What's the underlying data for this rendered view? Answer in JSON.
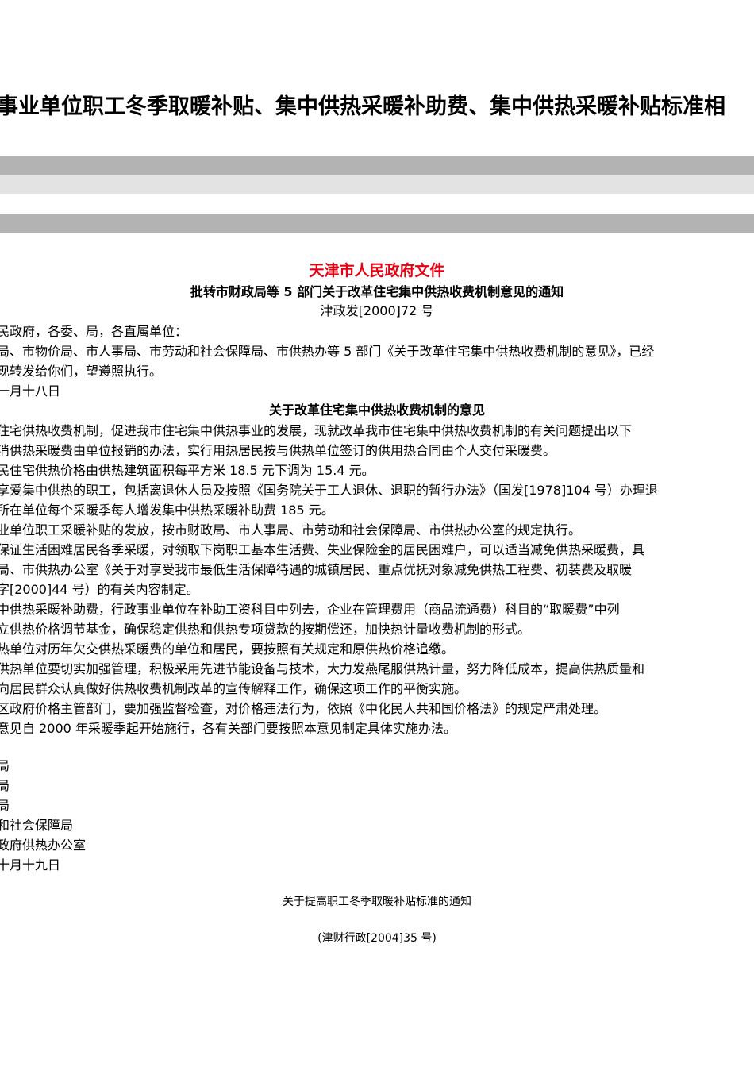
{
  "title": "事业单位职工冬季取暖补贴、集中供热采暖补助费、集中供热采暖补贴标准相",
  "header": {
    "issuer": "天津市人民政府文件",
    "issuer_color": "#e60012",
    "subtitle": "批转市财政局等 5 部门关于改革住宅集中供热收费机制意见的通知",
    "doc_number": "津政发[2000]72 号"
  },
  "notice_lines": [
    "民政府，各委、局，各直属单位：",
    "局、市物价局、市人事局、市劳动和社会保障局、市供热办等 5 部门《关于改革住宅集中供热收费机制的意见》，已经",
    "现转发给你们，望遵照执行。",
    "一月十八日"
  ],
  "section": {
    "title": "关于改革住宅集中供热收费机制的意见",
    "lines": [
      "住宅供热收费机制，促进我市住宅集中供热事业的发展，现就改革我市住宅集中供热收费机制的有关问题提出以下",
      "消供热采暖费由单位报销的办法，实行用热居民按与供热单位签订的供用热合同由个人交付采暖费。",
      "民住宅供热价格由供热建筑面积每平方米 18.5 元下调为 15.4 元。",
      "享爱集中供热的职工，包括离退休人员及按照《国务院关于工人退休、退职的暂行办法》（国发[1978]104 号）办理退",
      "所在单位每个采暖季每人增发集中供热采暖补助费 185 元。",
      "业单位职工采暖补贴的发放，按市财政局、市人事局、市劳动和社会保障局、市供热办公室的规定执行。",
      "保证生活困难居民各季采暖，对领取下岗职工基本生活费、失业保险金的居民困难户，可以适当减免供热采暖费，具",
      "局、市供热办公室《关于对享受我市最低生活保障待遇的城镇居民、重点优抚对象减免供热工程费、初装费及取暖",
      "字[2000]44 号）的有关内容制定。",
      "中供热采暖补助费，行政事业单位在补助工资科目中列去，企业在管理费用（商品流通费）科目的“取暖费”中列",
      "立供热价格调节基金，确保稳定供热和供热专项贷款的按期偿还，加快热计量收费机制的形式。",
      "热单位对历年欠交供热采暖费的单位和居民，要按照有关规定和原供热价格追缴。",
      "供热单位要切实加强管理，积极采用先进节能设备与技术，大力发燕尾服供热计量，努力降低成本，提高供热质量和",
      "向居民群众认真做好供热收费机制改革的宣传解释工作，确保这项工作的平衡实施。",
      "区政府价格主管部门，要加强监督检查，对价格违法行为，依照《中化民人共和国价格法》的规定严肃处理。",
      "意见自 2000 年采暖季起开始施行，各有关部门要按照本意见制定具体实施办法。"
    ]
  },
  "signatories": [
    "局",
    "局",
    "局",
    "和社会保障局",
    "政府供热办公室",
    "十月十九日"
  ],
  "footer": {
    "notice_title": "关于提高职工冬季取暖补贴标准的通知",
    "notice_number": "(津财行政[2004]35 号)"
  }
}
